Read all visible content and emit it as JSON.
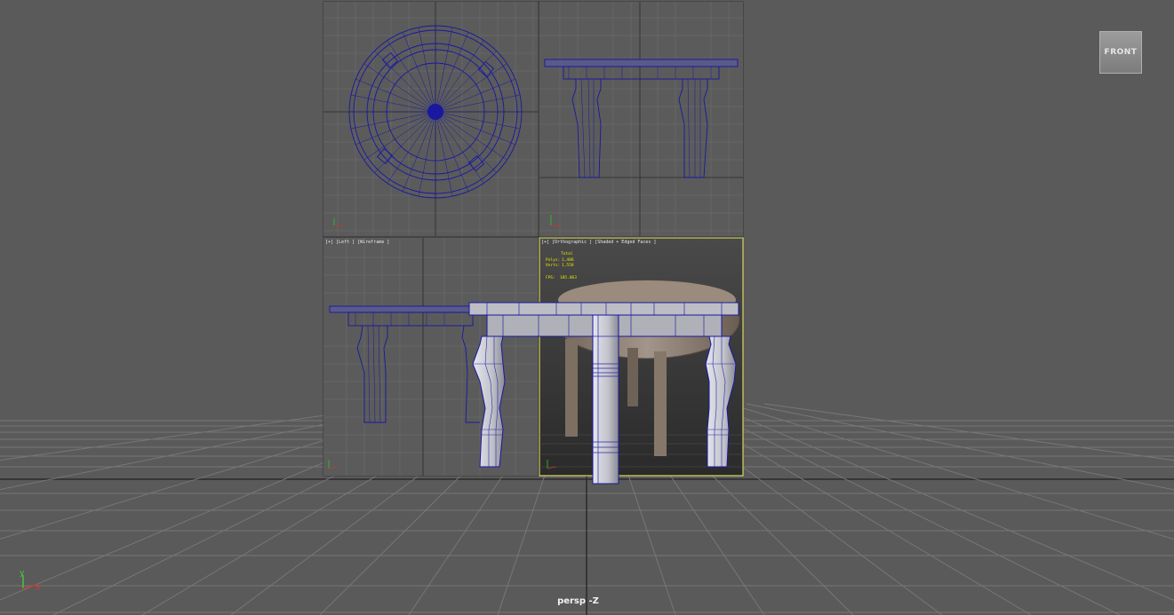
{
  "viewcube": {
    "label": "FRONT"
  },
  "camera": {
    "label": "persp -Z"
  },
  "reference_image": {
    "bottom_left_label": "[+] [Left ] [Wireframe ]",
    "bottom_right_label": "[+] [Orthographic ] [Shaded + Edged Faces ]",
    "stats": {
      "header": "Total",
      "polys_label": "Polys:",
      "polys_value": "1,486",
      "verts_label": "Verts:",
      "verts_value": "1,558",
      "fps_label": "FPS:",
      "fps_value": "185.863"
    }
  },
  "axis": {
    "x": "x",
    "y": "y"
  },
  "colors": {
    "viewport_bg": "#5a5a5a",
    "grid": "#6e6e6e",
    "grid_dark": "#2a2a2a",
    "wire_blue": "#1818a0",
    "mesh_fill": "#bcbcc4",
    "active_border": "#d8d860"
  }
}
